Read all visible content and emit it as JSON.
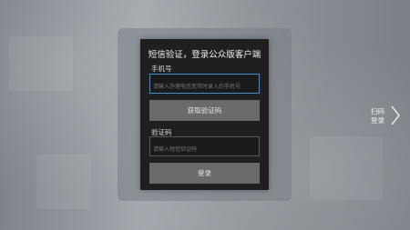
{
  "dialog": {
    "title": "短信验证，登录公众版客户端",
    "phone_label": "手机号",
    "phone_placeholder": "请输入办理电信宽带时录入的手机号",
    "get_code_button": "获取验证码",
    "code_label": "验证码",
    "code_placeholder": "请输入短信验证码",
    "login_button": "登录"
  },
  "side": {
    "scan_line1": "扫码",
    "scan_line2": "登录",
    "icon": "chevron-right-icon"
  },
  "colors": {
    "card_bg": "#1f1f1f",
    "button_bg": "#6a6a6a",
    "focus_border": "#3d8ce0"
  }
}
